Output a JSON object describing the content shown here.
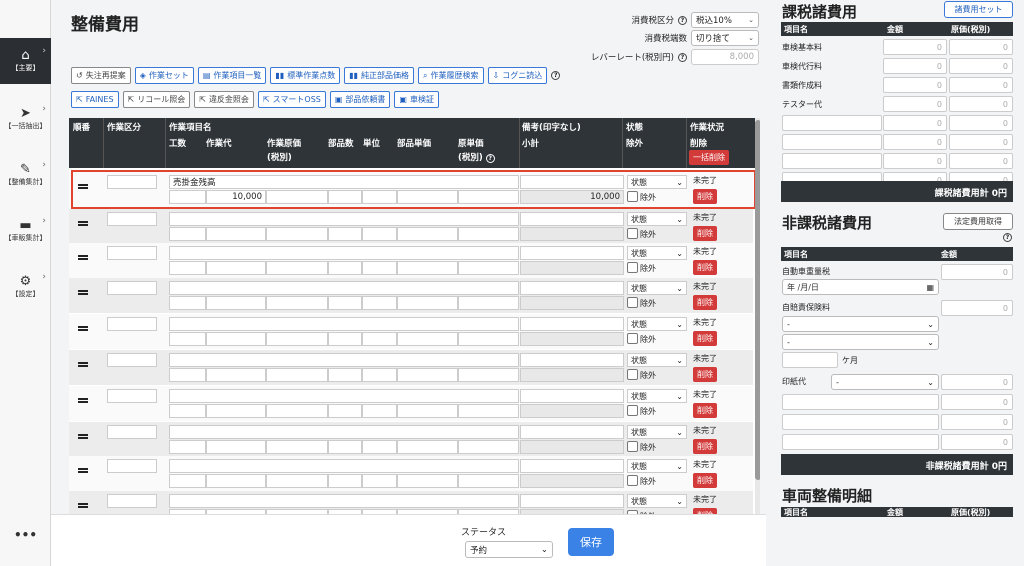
{
  "sidebar": {
    "items": [
      {
        "label": "【主要】",
        "icon": "home-icon"
      },
      {
        "label": "【一括抽出】",
        "icon": "file-export-icon"
      },
      {
        "label": "【整備集計】",
        "icon": "tools-icon"
      },
      {
        "label": "【車販集計】",
        "icon": "car-icon"
      },
      {
        "label": "【設定】",
        "icon": "gear-icon"
      }
    ],
    "more": "•••"
  },
  "main": {
    "title": "整備費用",
    "tax_type_label": "消費税区分",
    "tax_type_value": "税込10%",
    "tax_round_label": "消費税端数",
    "tax_round_value": "切り捨て",
    "labor_rate_label": "レバーレート(税別円)",
    "labor_rate_placeholder": "8,000",
    "buttons_row1": [
      "失注再提案",
      "作業セット",
      "作業項目一覧",
      "標準作業点数",
      "純正部品価格",
      "作業履歴検索",
      "コグニ読込"
    ],
    "buttons_row2": [
      "FAINES",
      "リコール照会",
      "違反金照会",
      "スマートOSS",
      "部品依頼書",
      "車検証"
    ]
  },
  "table": {
    "headers": {
      "order": "順番",
      "work_type": "作業区分",
      "work_item": "作業項目名",
      "labor_hours": "工数",
      "labor_cost": "作業代",
      "work_cost": "作業原価",
      "work_cost2": "(税別)",
      "parts_qty": "部品数",
      "unit": "単位",
      "parts_price": "部品単価",
      "cost_price": "原単価",
      "cost_price2": "(税別)",
      "notes": "備考(印字なし)",
      "subtotal": "小計",
      "status": "状態",
      "exclude": "除外",
      "work_status": "作業状況",
      "delete": "削除",
      "bulk_delete": "一括削除"
    },
    "first_row": {
      "item_name": "売掛金残高",
      "labor_cost": "10,000",
      "subtotal": "10,000"
    },
    "status_placeholder": "状態",
    "exclude_label": "除外",
    "incomplete_label": "未完了",
    "delete_label": "削除"
  },
  "right": {
    "taxable": {
      "title": "課税諸費用",
      "set_button": "諸費用セット",
      "col_item": "項目名",
      "col_amount": "金額",
      "col_cost": "原価(税別)",
      "items": [
        "車検基本料",
        "車検代行料",
        "書類作成料",
        "テスター代"
      ],
      "zero": "0",
      "total": "課税諸費用計 0円"
    },
    "nontaxable": {
      "title": "非課税諸費用",
      "legal_button": "法定費用取得",
      "col_item": "項目名",
      "col_amount": "金額",
      "weight_tax": "自動車重量税",
      "date_placeholder": "年 /月/日",
      "insurance": "自賠責保険料",
      "dash": "-",
      "months": "ケ月",
      "stamp": "印紙代",
      "zero": "0",
      "total": "非課税諸費用計 0円"
    },
    "vehicle": {
      "title": "車両整備明細",
      "col_item": "項目名",
      "col_amount": "金額",
      "col_cost": "原価(税別)"
    }
  },
  "footer": {
    "status_label": "ステータス",
    "status_value": "予約",
    "save_label": "保存"
  }
}
